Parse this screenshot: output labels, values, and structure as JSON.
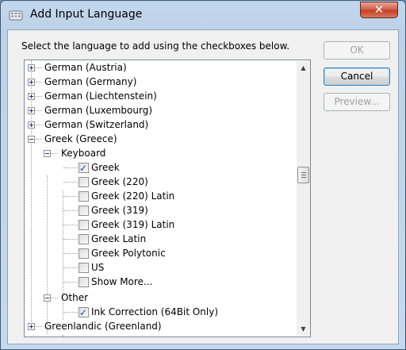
{
  "window": {
    "title": "Add Input Language",
    "close_label": "✕"
  },
  "instructions": "Select the language to add using the checkboxes below.",
  "buttons": {
    "ok": "OK",
    "cancel": "Cancel",
    "preview": "Preview..."
  },
  "tree": {
    "languages": [
      "German (Austria)",
      "German (Germany)",
      "German (Liechtenstein)",
      "German (Luxembourg)",
      "German (Switzerland)"
    ],
    "expanded_language": "Greek (Greece)",
    "keyboard_group": "Keyboard",
    "keyboards": [
      {
        "label": "Greek",
        "checked": true
      },
      {
        "label": "Greek (220)",
        "checked": false
      },
      {
        "label": "Greek (220) Latin",
        "checked": false
      },
      {
        "label": "Greek (319)",
        "checked": false
      },
      {
        "label": "Greek (319) Latin",
        "checked": false
      },
      {
        "label": "Greek Latin",
        "checked": false
      },
      {
        "label": "Greek Polytonic",
        "checked": false
      },
      {
        "label": "US",
        "checked": false
      },
      {
        "label": "Show More...",
        "checked": false
      }
    ],
    "other_group": "Other",
    "other_items": [
      {
        "label": "Ink Correction (64Bit Only)",
        "checked": true
      }
    ],
    "next_language": "Greenlandic (Greenland)"
  },
  "colors": {
    "close_button": "#c43f26",
    "checkmark": "#21409e",
    "window_frame": "#bdd2e8"
  }
}
